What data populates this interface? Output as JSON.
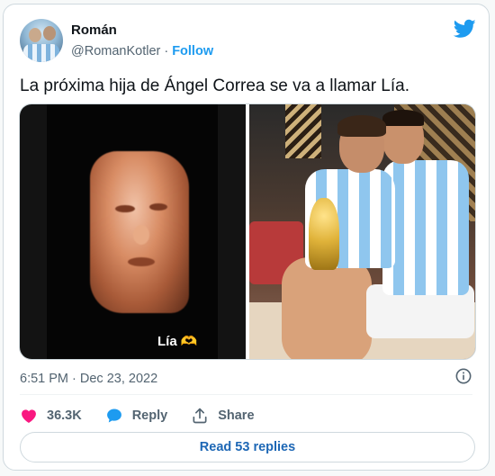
{
  "author": {
    "name": "Román",
    "handle": "@RomanKotler",
    "separator": "·",
    "follow_label": "Follow"
  },
  "brand": {
    "icon": "twitter-bird-icon",
    "color": "#1d9bf0"
  },
  "tweet": {
    "text": "La próxima hija de Ángel Correa se va a llamar Lía."
  },
  "media": {
    "left_image": {
      "overlay_text": "Lía",
      "overlay_emoji": "🫶"
    },
    "right_image": {}
  },
  "meta": {
    "timestamp": "6:51 PM · Dec 23, 2022"
  },
  "actions": {
    "likes_count": "36.3K",
    "reply_label": "Reply",
    "share_label": "Share",
    "like_icon": "heart-icon",
    "reply_icon": "speech-bubble-icon",
    "share_icon": "share-upload-icon",
    "like_color": "#f91880",
    "reply_color": "#1d9bf0"
  },
  "replies_button": {
    "label": "Read 53 replies"
  }
}
